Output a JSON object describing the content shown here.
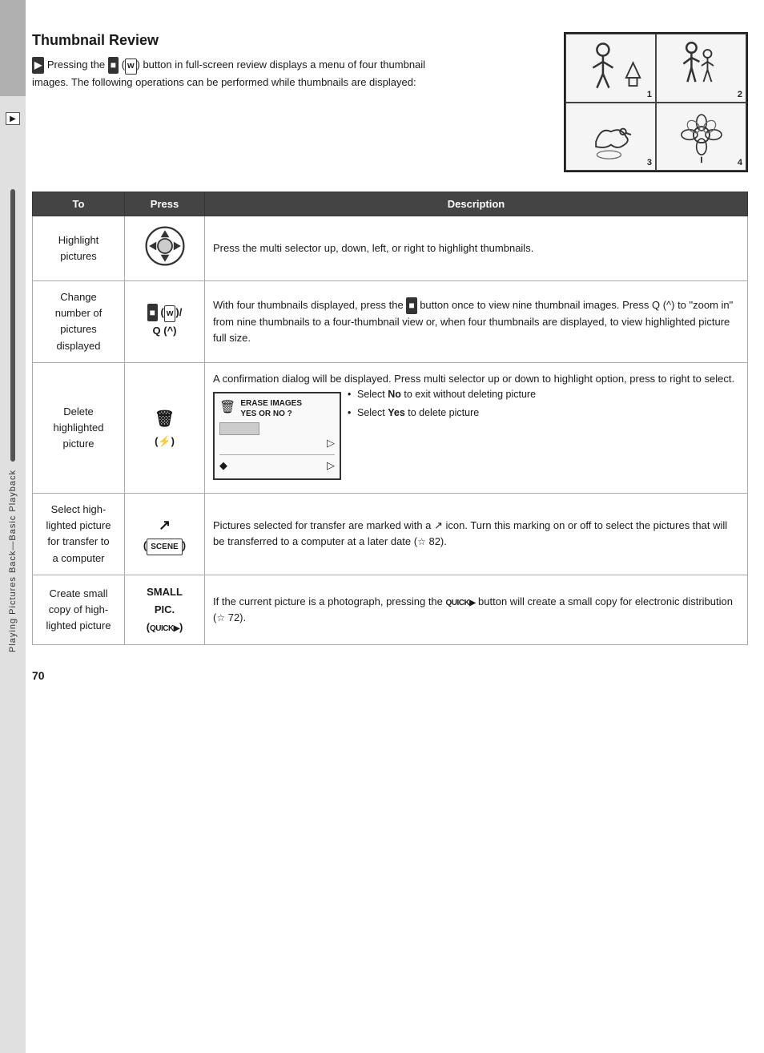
{
  "sidebar": {
    "label": "Playing Pictures Back—Basic Playback"
  },
  "header": {
    "title": "Thumbnail Review",
    "description_parts": [
      "Pressing the",
      "button in full-screen review displays a menu of four thumbnail images.  The following operations can be performed while thumbnails are displayed:"
    ],
    "button_icon": "▶",
    "w_icon": "w"
  },
  "thumbnail_grid": {
    "cells": [
      {
        "num": "1"
      },
      {
        "num": "2"
      },
      {
        "num": "3"
      },
      {
        "num": "4"
      }
    ]
  },
  "table": {
    "col_to": "To",
    "col_press": "Press",
    "col_desc": "Description",
    "rows": [
      {
        "to": "Highlight pictures",
        "press": "multi-selector",
        "description": "Press the multi selector up, down, left, or right to highlight thumbnails."
      },
      {
        "to": "Change number of pictures displayed",
        "press": "■ (w)/\nQ (^)",
        "description": "With four thumbnails displayed, press the ■ button once to view nine thumbnail images.  Press Q (^) to \"zoom in\" from nine thumbnails to a four-thumbnail view or, when four thumbnails are displayed, to view highlighted picture full size."
      },
      {
        "to": "Delete highlighted picture",
        "press": "🗑 (⚡)",
        "description_top": "A confirmation dialog will be displayed.  Press multi selector up or down to highlight option, press to right to select.",
        "bullet_no": "Select No to exit without deleting picture",
        "bullet_yes": "Select Yes to delete picture",
        "erase_label": "ERASE IMAGES\nYES OR NO ?"
      },
      {
        "to": "Select highlighted picture for transfer to a computer",
        "press": "↗\n(SCENE)",
        "description": "Pictures selected for transfer are marked with a ↗ icon.  Turn this marking on or off to select the pictures that will be transferred to a computer at a later date (☆ 82)."
      },
      {
        "to": "Create small copy of highlighted picture",
        "press": "SMALL\nPIC.\n(QUICK▶)",
        "description": "If the current picture is a photograph, pressing the QUICK▶ button will create a small copy for electronic distribution (☆ 72)."
      }
    ]
  },
  "page_number": "70"
}
